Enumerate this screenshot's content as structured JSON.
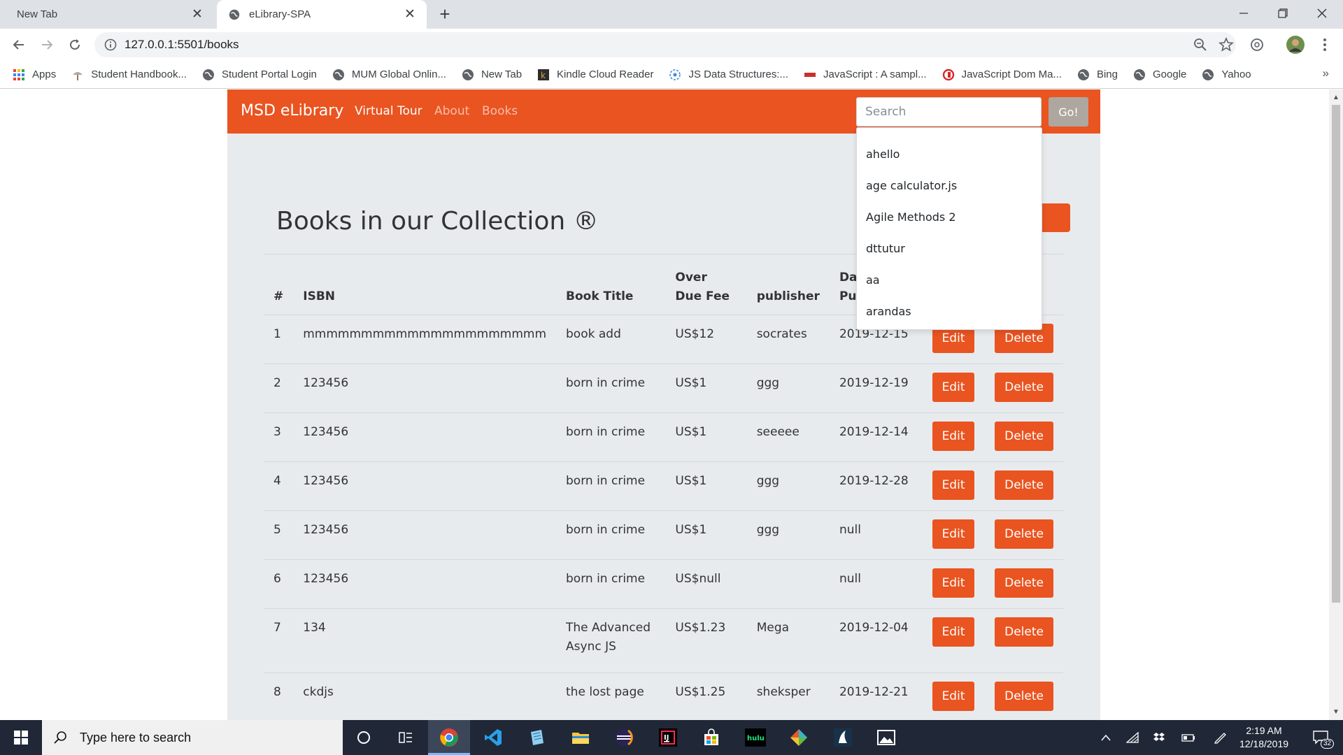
{
  "browser": {
    "tabs": [
      {
        "title": "New Tab",
        "active": false
      },
      {
        "title": "eLibrary-SPA",
        "active": true
      }
    ],
    "url": "127.0.0.1:5501/books",
    "bookmarks": [
      {
        "label": "Apps",
        "icon": "apps-grid-icon"
      },
      {
        "label": "Student Handbook...",
        "icon": "handbook-icon"
      },
      {
        "label": "Student Portal Login",
        "icon": "globe-icon"
      },
      {
        "label": "MUM Global Onlin...",
        "icon": "globe-icon"
      },
      {
        "label": "New Tab",
        "icon": "globe-icon"
      },
      {
        "label": "Kindle Cloud Reader",
        "icon": "kindle-icon"
      },
      {
        "label": "JS Data Structures:...",
        "icon": "codecast-icon"
      },
      {
        "label": "JavaScript : A sampl...",
        "icon": "slides-icon"
      },
      {
        "label": "JavaScript Dom Ma...",
        "icon": "red-logo-icon"
      },
      {
        "label": "Bing",
        "icon": "globe-icon"
      },
      {
        "label": "Google",
        "icon": "globe-icon"
      },
      {
        "label": "Yahoo",
        "icon": "globe-icon"
      }
    ]
  },
  "app": {
    "brand": "MSD eLibrary",
    "nav": [
      "Virtual Tour",
      "About",
      "Books"
    ],
    "search_placeholder": "Search",
    "go_label": "Go!",
    "accent": "#e95420",
    "suggestions": [
      "ahello",
      "age calculator.js",
      "Agile Methods 2",
      "dttutur",
      "aa",
      "arandas"
    ]
  },
  "page": {
    "title": "Books in our Collection ®",
    "columns": [
      "#",
      "ISBN",
      "Book Title",
      "Over Due Fee",
      "publisher",
      "Date Published"
    ],
    "edit_label": "Edit",
    "delete_label": "Delete",
    "rows": [
      {
        "num": "1",
        "isbn": "mmmmmmmmmmmmmmmmmmmmm",
        "title": "book add",
        "fee": "US$12",
        "publisher": "socrates",
        "date": "2019-12-15"
      },
      {
        "num": "2",
        "isbn": "123456",
        "title": "born in crime",
        "fee": "US$1",
        "publisher": "ggg",
        "date": "2019-12-19"
      },
      {
        "num": "3",
        "isbn": "123456",
        "title": "born in crime",
        "fee": "US$1",
        "publisher": "seeeee",
        "date": "2019-12-14"
      },
      {
        "num": "4",
        "isbn": "123456",
        "title": "born in crime",
        "fee": "US$1",
        "publisher": "ggg",
        "date": "2019-12-28"
      },
      {
        "num": "5",
        "isbn": "123456",
        "title": "born in crime",
        "fee": "US$1",
        "publisher": "ggg",
        "date": "null"
      },
      {
        "num": "6",
        "isbn": "123456",
        "title": "born in crime",
        "fee": "US$null",
        "publisher": "",
        "date": "null"
      },
      {
        "num": "7",
        "isbn": "134",
        "title": "The Advanced Async JS",
        "fee": "US$1.23",
        "publisher": "Mega",
        "date": "2019-12-04"
      },
      {
        "num": "8",
        "isbn": "ckdjs",
        "title": "the lost page",
        "fee": "US$1.25",
        "publisher": "sheksper",
        "date": "2019-12-21"
      }
    ]
  },
  "taskbar": {
    "search_placeholder": "Type here to search",
    "time": "2:19 AM",
    "date": "12/18/2019",
    "notifications": "32",
    "apps": [
      "cortana-icon",
      "task-view-icon",
      "chrome-icon",
      "vscode-icon",
      "notepad-icon",
      "file-explorer-icon",
      "eclipse-icon",
      "intellij-icon",
      "store-icon",
      "hulu-icon",
      "git-icon",
      "kindle-app-icon",
      "photos-icon"
    ]
  }
}
